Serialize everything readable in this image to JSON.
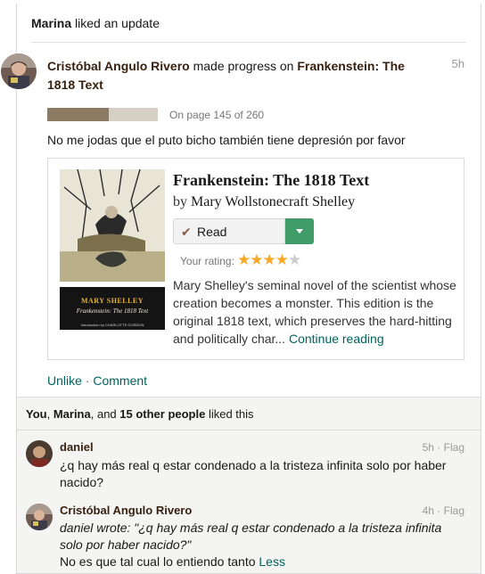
{
  "header": {
    "liker_name": "Marina",
    "liker_action": " liked an update"
  },
  "update": {
    "actor": "Cristóbal Angulo Rivero",
    "verb": " made progress on ",
    "book_title": "Frankenstein: The 1818 Text",
    "time": "5h",
    "progress_text": "On page 145 of 260",
    "progress_fraction": 0.558,
    "status": "No me jodas que el puto bicho también tiene depresión por favor"
  },
  "book": {
    "title": "Frankenstein: The 1818 Text",
    "by": "by ",
    "author": "Mary Wollstonecraft Shelley",
    "cover_author": "MARY SHELLEY",
    "cover_title": "Frankenstein: The 1818 Text",
    "cover_intro": "Introduction by CHARLOTTE GORDON",
    "shelf_label": "Read",
    "shelf_icon": "check-icon",
    "rating_label": "Your rating:",
    "rating": 4,
    "rating_max": 5,
    "description": "Mary Shelley's seminal novel of the scientist whose creation becomes a monster. This edition is the original 1818 text, which preserves the hard-hitting and politically char... ",
    "continue_label": "Continue reading"
  },
  "actions": {
    "unlike": "Unlike",
    "separator": " · ",
    "comment": "Comment"
  },
  "likes": {
    "part1": "You",
    "part2": ", ",
    "part3": "Marina",
    "part4": ", and ",
    "part5": "15 other people",
    "part6": " liked this"
  },
  "comments": [
    {
      "name": "daniel",
      "time": "5h",
      "meta_sep": " · ",
      "flag": "Flag",
      "text": "¿q hay más real q estar condenado a la tristeza infinita solo por haber nacido?"
    },
    {
      "name": "Cristóbal Angulo Rivero",
      "time": "4h",
      "meta_sep": " · ",
      "flag": "Flag",
      "quote": "daniel wrote: \"¿q hay más real q estar condenado a la tristeza infinita solo por haber nacido?\"",
      "text": "No es que tal cual lo entiendo tanto ",
      "less": "Less"
    }
  ],
  "colors": {
    "link": "#00635d",
    "name": "#382110",
    "progress_fill": "#8c7b62",
    "shelf_green": "#409d69",
    "star": "#f9a825"
  }
}
